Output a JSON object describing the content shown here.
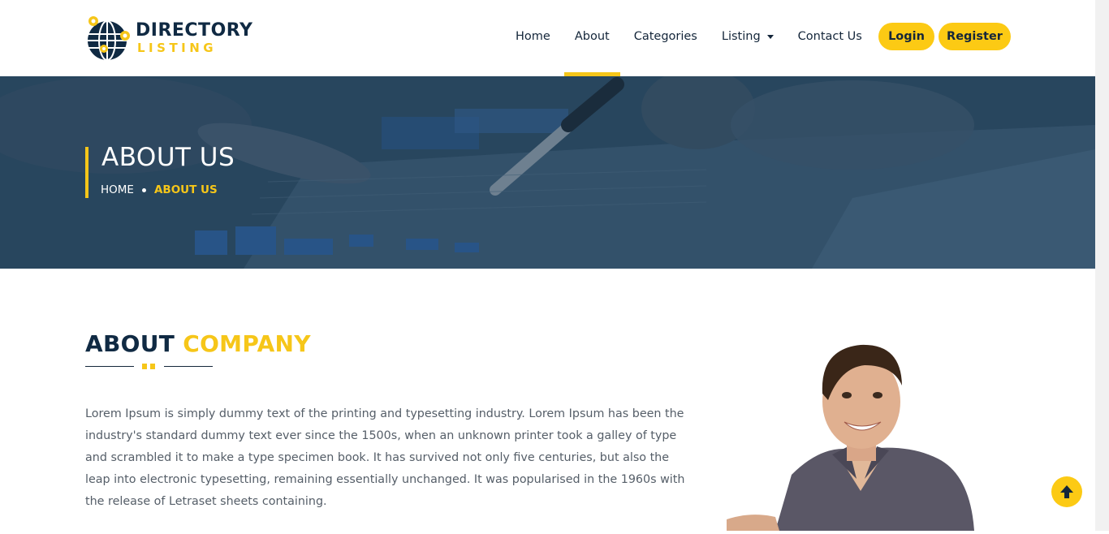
{
  "logo": {
    "line1": "DIRECTORY",
    "line2": "LISTING"
  },
  "nav": {
    "items": [
      {
        "label": "Home"
      },
      {
        "label": "About"
      },
      {
        "label": "Categories"
      },
      {
        "label": "Listing"
      },
      {
        "label": "Contact Us"
      }
    ],
    "login_label": "Login",
    "register_label": "Register"
  },
  "banner": {
    "title": "ABOUT US",
    "breadcrumb_home": "HOME",
    "breadcrumb_current": "ABOUT US"
  },
  "about": {
    "heading_main": "ABOUT",
    "heading_accent": "COMPANY",
    "paragraph": "Lorem Ipsum is simply dummy text of the printing and typesetting industry. Lorem Ipsum has been the industry's standard dummy text ever since the 1500s, when an unknown printer took a galley of type and scrambled it to make a type specimen book. It has survived not only five centuries, but also the leap into electronic typesetting, remaining essentially unchanged. It was popularised in the 1960s with the release of Letraset sheets containing."
  },
  "colors": {
    "accent": "#f6c619",
    "navy": "#102a43",
    "banner_overlay": "#2e4c63"
  },
  "icons": {
    "back_to_top": "arrow-up-icon",
    "listing_caret": "caret-down-icon"
  }
}
